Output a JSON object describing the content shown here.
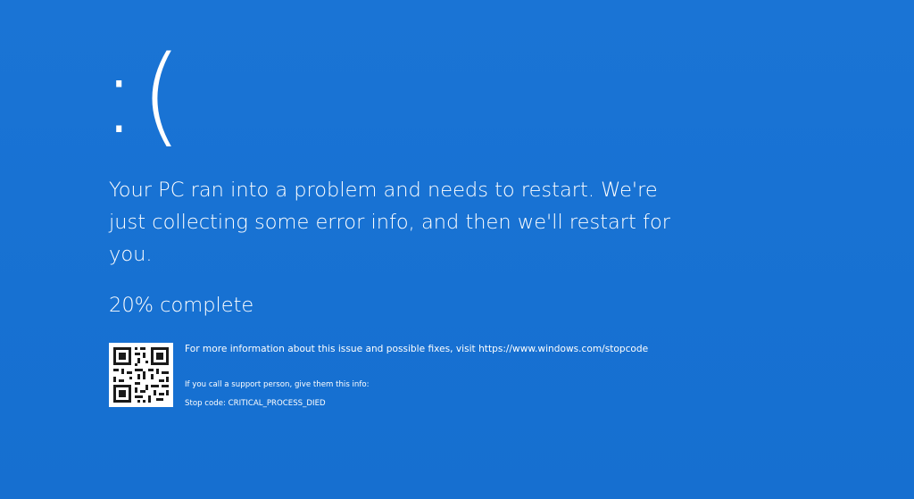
{
  "screen": {
    "background_color": "#1872d3",
    "text_color": "#ffffff",
    "emoticon": ":(",
    "headline": "Your PC ran into a problem and needs to restart. We're just collecting some error info, and then we'll restart for you.",
    "progress_text": "20% complete",
    "progress_percent": 20
  },
  "info": {
    "more_info": "For more information about this issue and possible fixes, visit https://www.windows.com/stopcode",
    "support_prompt": "If you call a support person, give them this info:",
    "stop_code": "Stop code: CRITICAL_PROCESS_DIED"
  },
  "qr_code": {
    "icon": "qr-code-icon"
  }
}
